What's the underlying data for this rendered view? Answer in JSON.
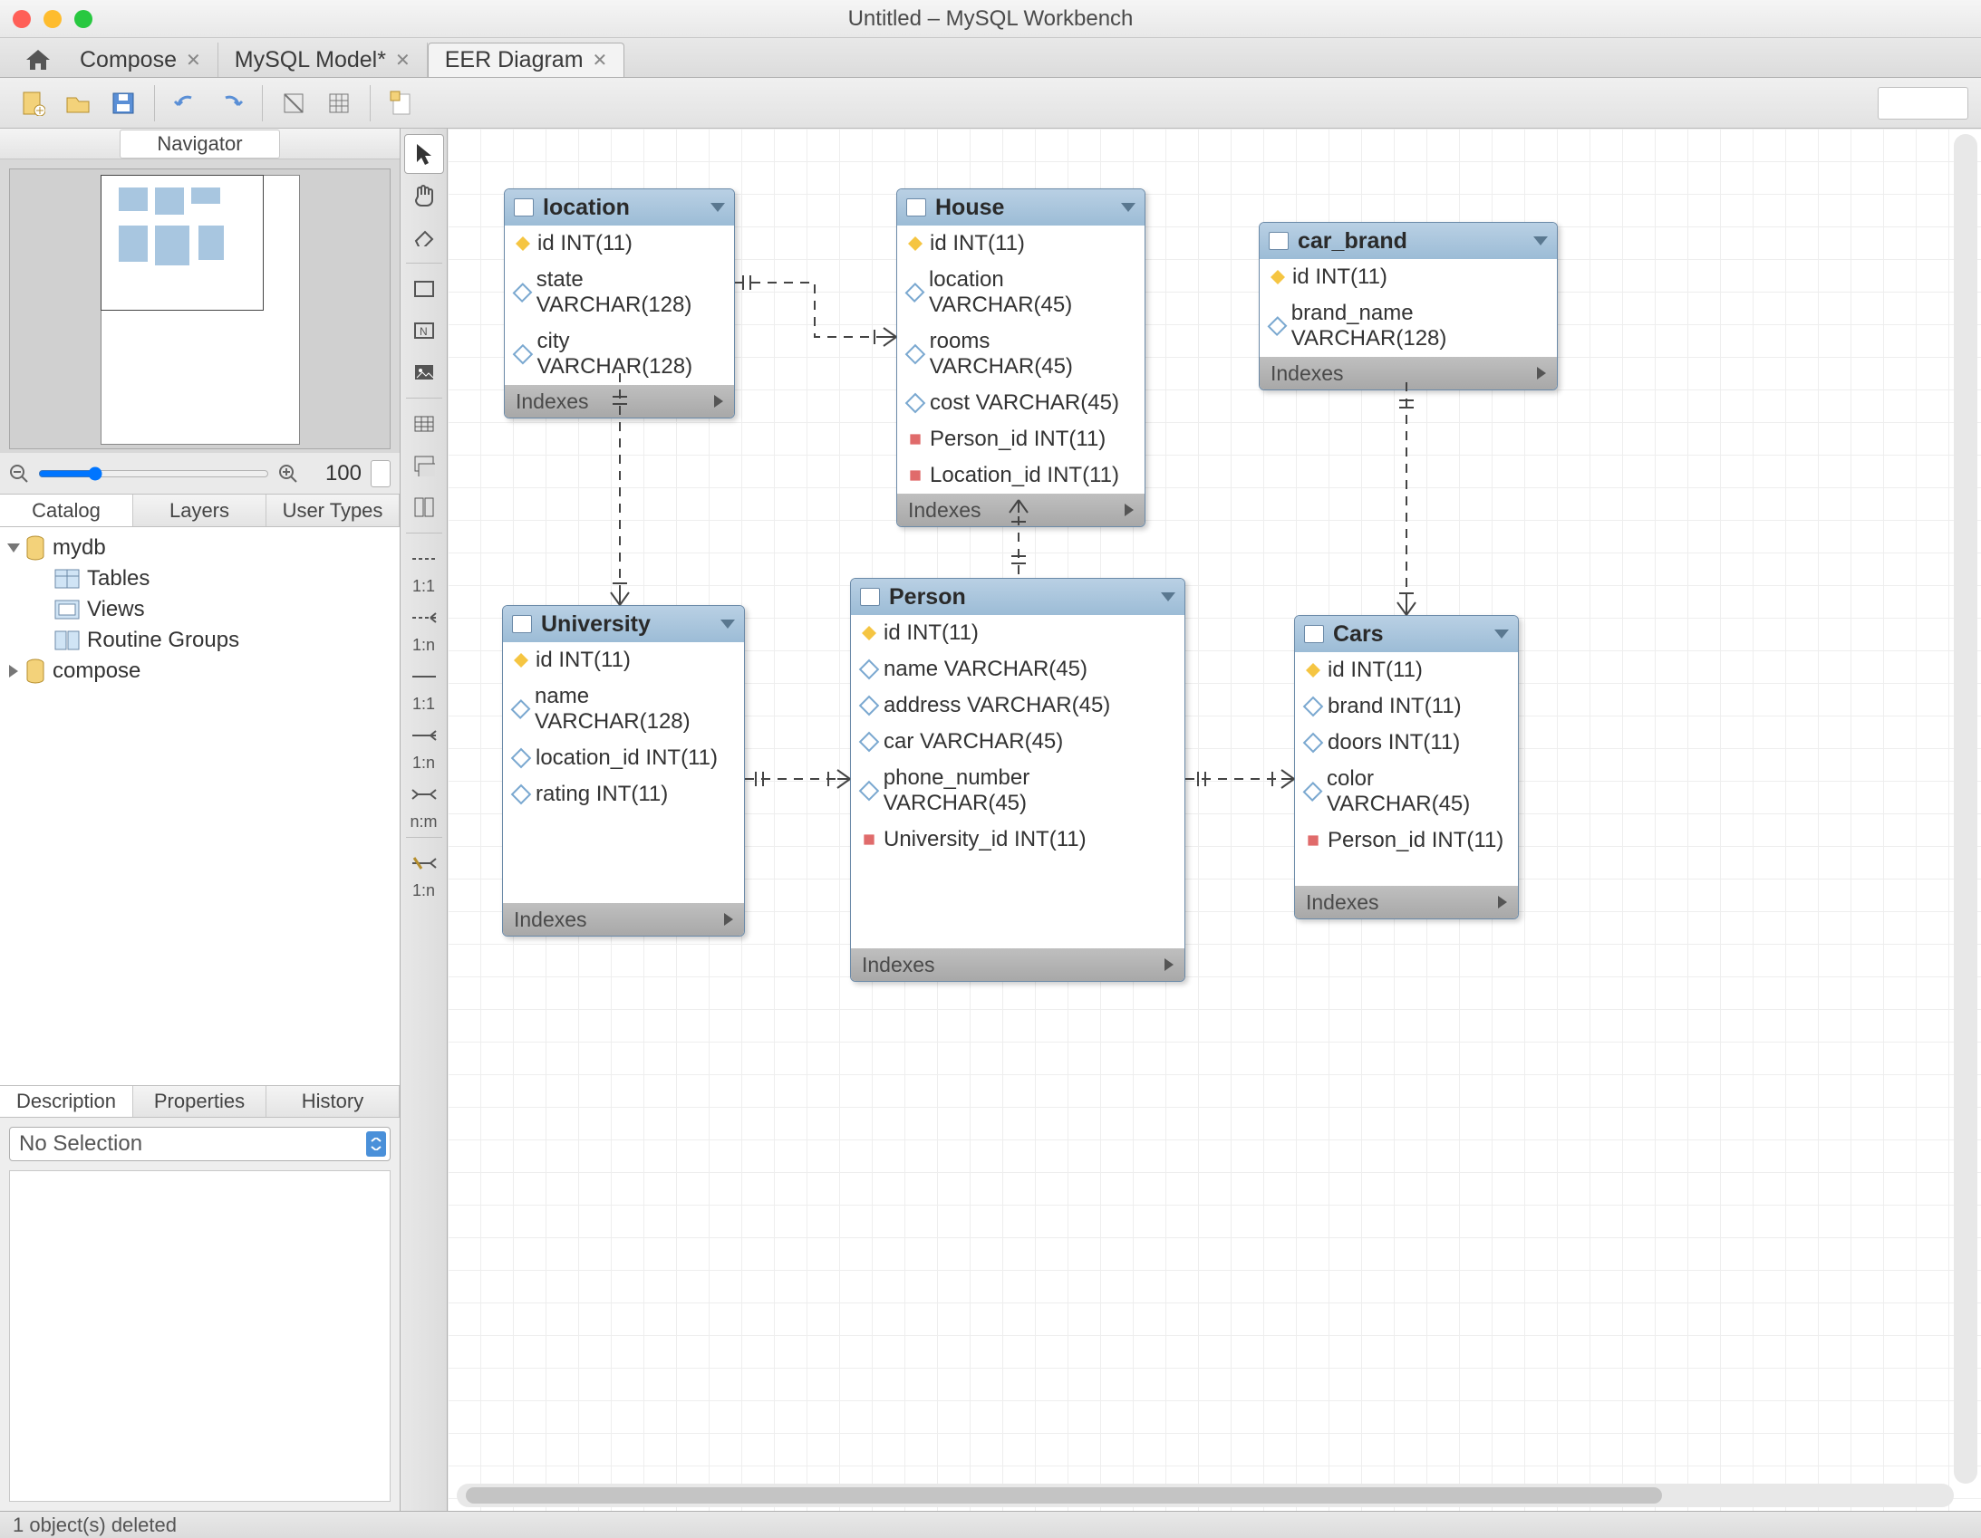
{
  "window": {
    "title": "Untitled – MySQL Workbench"
  },
  "tabs": [
    {
      "label": "Compose",
      "closable": true
    },
    {
      "label": "MySQL Model*",
      "closable": true
    },
    {
      "label": "EER Diagram",
      "closable": true,
      "active": true
    }
  ],
  "sidebar": {
    "navigator_label": "Navigator",
    "zoom": "100",
    "catalog_tabs": [
      "Catalog",
      "Layers",
      "User Types"
    ],
    "tree": {
      "db1": "mydb",
      "db1_children": [
        "Tables",
        "Views",
        "Routine Groups"
      ],
      "db2": "compose"
    },
    "desc_tabs": [
      "Description",
      "Properties",
      "History"
    ],
    "selection": "No Selection"
  },
  "entities": {
    "location": {
      "name": "location",
      "cols": [
        {
          "icon": "key",
          "text": "id INT(11)"
        },
        {
          "icon": "attr",
          "text": "state VARCHAR(128)"
        },
        {
          "icon": "attr",
          "text": "city VARCHAR(128)"
        }
      ],
      "indexes": "Indexes"
    },
    "house": {
      "name": "House",
      "cols": [
        {
          "icon": "key",
          "text": "id INT(11)"
        },
        {
          "icon": "attr",
          "text": "location VARCHAR(45)"
        },
        {
          "icon": "attr",
          "text": "rooms VARCHAR(45)"
        },
        {
          "icon": "attr",
          "text": "cost VARCHAR(45)"
        },
        {
          "icon": "fk",
          "text": "Person_id INT(11)"
        },
        {
          "icon": "fk",
          "text": "Location_id INT(11)"
        }
      ],
      "indexes": "Indexes"
    },
    "car_brand": {
      "name": "car_brand",
      "cols": [
        {
          "icon": "key",
          "text": "id INT(11)"
        },
        {
          "icon": "attr",
          "text": "brand_name VARCHAR(128)"
        }
      ],
      "indexes": "Indexes"
    },
    "university": {
      "name": "University",
      "cols": [
        {
          "icon": "key",
          "text": "id INT(11)"
        },
        {
          "icon": "attr",
          "text": "name VARCHAR(128)"
        },
        {
          "icon": "attr",
          "text": "location_id INT(11)"
        },
        {
          "icon": "attr",
          "text": "rating INT(11)"
        }
      ],
      "indexes": "Indexes"
    },
    "person": {
      "name": "Person",
      "cols": [
        {
          "icon": "key",
          "text": "id INT(11)"
        },
        {
          "icon": "attr",
          "text": "name VARCHAR(45)"
        },
        {
          "icon": "attr",
          "text": "address VARCHAR(45)"
        },
        {
          "icon": "attr",
          "text": "car VARCHAR(45)"
        },
        {
          "icon": "attr",
          "text": "phone_number VARCHAR(45)"
        },
        {
          "icon": "fk",
          "text": "University_id INT(11)"
        }
      ],
      "indexes": "Indexes"
    },
    "cars": {
      "name": "Cars",
      "cols": [
        {
          "icon": "key",
          "text": "id INT(11)"
        },
        {
          "icon": "attr",
          "text": "brand INT(11)"
        },
        {
          "icon": "attr",
          "text": "doors INT(11)"
        },
        {
          "icon": "attr",
          "text": "color VARCHAR(45)"
        },
        {
          "icon": "fk",
          "text": "Person_id INT(11)"
        }
      ],
      "indexes": "Indexes"
    }
  },
  "status": "1 object(s) deleted"
}
